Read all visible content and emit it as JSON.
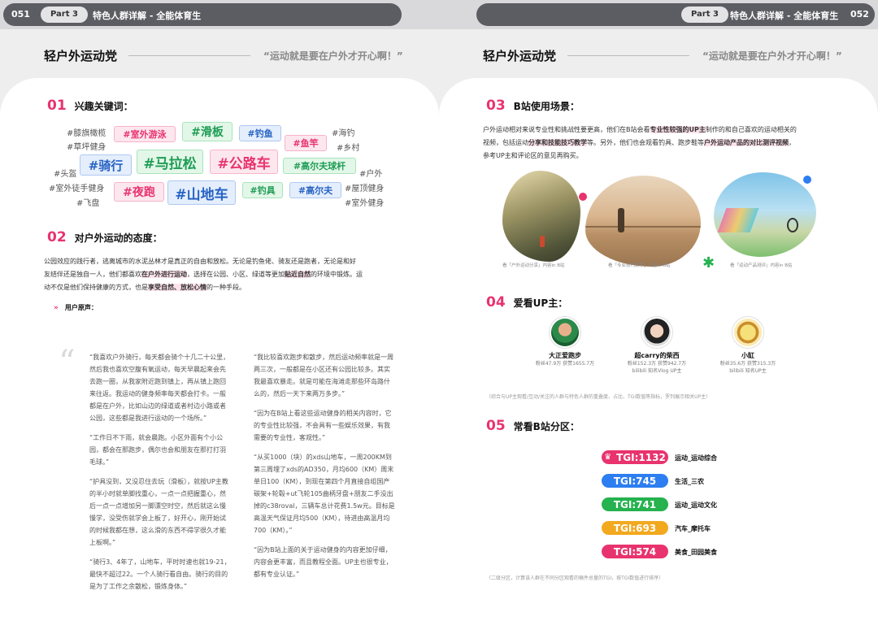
{
  "header": {
    "page_left": "051",
    "page_right": "052",
    "part_left": "Part 3",
    "part_right": "Part 3",
    "title_left": "特色人群详解 - 全能体育生",
    "title_right": "特色人群详解 - 全能体育生"
  },
  "left": {
    "heading": "轻户外运动党",
    "quote": "“运动就是要在户外才开心啊！”",
    "s1_num": "01",
    "s1_title": "兴趣关键词：",
    "keywords": [
      "#膝旗橄榄",
      "#草坪健身",
      "#头盔",
      "#室外徒手健身",
      "#飞盘",
      "#海钓",
      "#乡村",
      "#户外",
      "#屋顶健身",
      "#室外健身"
    ],
    "tags": [
      "#室外游泳",
      "#滑板",
      "#钓鱼",
      "#鱼竿",
      "#骑行",
      "#马拉松",
      "#公路车",
      "#高尔夫球杆",
      "#夜跑",
      "#山地车",
      "#钓具",
      "#高尔夫"
    ],
    "s2_num": "02",
    "s2_title": "对户外运动的态度：",
    "attitude": {
      "p1": "公园效应的践行者，逃离城市的水泥丛林才是真正的自由和放松。无论是钓鱼佬、骑友还是跑者，无论是和好",
      "p2a": "友结伴还是独自一人，他们都喜欢",
      "p2h": "在户外进行运动",
      "p2b": "，选择在公园、小区、绿道等更加",
      "p2h2": "贴近自然",
      "p2c": "的环境中锻炼。运",
      "p3a": "动不仅是他们保持健康的方式，也是",
      "p3h": "享受自然、放松心情",
      "p3b": "的一种手段。"
    },
    "voice_label": "用户原声：",
    "quotes_left": [
      "“我喜欢户外骑行，每天都会骑个十几二十公里，然后我也喜欢空腹有氧运动，每天早晨起来会先去跑一圈，从我家附近跑到镇上，再从镇上跑回来往返。我运动的健身频率每天都会打卡。一般都是在户外，比如山边的绿道或者村边小路或者公园，这些都是我进行运动的一个场所。”",
      "“工作日不下雨，就会晨跑。小区外面有个小公园，都会在那跑步，偶尔也会和朋友在那打打羽毛球。”",
      "“护具没到，又没忍住去玩（滑板），就按UP主教的半小时就单脚找重心，一点一点把握重心，然后一点一点增加另一脚漂空时空，然后就这么慢慢学，没受伤就学会上板了，好开心，刚开始试的时候我都在想，这么滑的东西不得学很久才能上板啊。”",
      "“骑行3、4年了，山地车，平时时速也就19-21，最快不超过22。一个人骑行看自由。骑行的目的是为了工作之余散松，锻炼身体。”"
    ],
    "quotes_right": [
      "“我比较喜欢跑步和散步，然后运动频率就是一周两三次，一般都是在小区还有公园比较多。其实我最喜欢暴走。就是可能在海滩走那些环岛路什么的，然后一天下来两万多步。”",
      "“因为在B站上看这些运动健身的相关内容时，它的专业性比较强，不会具有一些娱乐效果，有我需要的专业性，客观性。”",
      "“从买1000（块）的xds山地车，一周200KM到第三周埋了xds的AD350，月均600（KM）周末单日100（KM），到现在第四个月直接自组国产碳架+轮毂+ut飞轮105曲柄牙盘+朋友二手没出掉的c38roval，三辆车总计花费1.5w元。目标是高温天气保证月均500（KM），待进由高温月均700（KM）。”",
      "“因为B站上面的关于运动健身的内容更加仔细，内容会更丰富，而且教程全面。UP主也很专业，都有专业认证。”"
    ]
  },
  "right": {
    "heading": "轻户外运动党",
    "quote": "“运动就是要在户外才开心啊！”",
    "s3_num": "03",
    "s3_title": "B站使用场景：",
    "scene": {
      "l1a": "户外运动相对来说专业性和挑战性要更高，他们在B站会看",
      "l1h": "专业性较强的UP主",
      "l1b": "制作的和自己喜欢的运动相关的",
      "l2a": "视频，包括运动",
      "l2h": "分享和技能技巧教学",
      "l2b": "等。另外，他们也会观看钓具、跑步鞋等",
      "l2h2": "户外运动产品的对比测评视频",
      "l2c": "，",
      "l3": "参考UP主和评论区的意见再购买。"
    },
    "captions": [
      "看「户外运动分享」内容in B站",
      "看「专业技巧教学」内容in B站",
      "看「运动产品测评」内容in B站"
    ],
    "s4_num": "04",
    "s4_title": "爱看UP主：",
    "ups": [
      {
        "name": "大正爱跑步",
        "stats": "粉丝47.9万 获赞1655.7万",
        "extra": ""
      },
      {
        "name": "超carry的柴西",
        "stats": "粉丝152.3万 获赞942.7万",
        "extra": "bilibili 知名Vlog UP主"
      },
      {
        "name": "小缸",
        "stats": "粉丝35.6万 获赞315.3万",
        "extra": "bilibili 知名UP主"
      }
    ],
    "up_note": "（综合与UP主观看/互动/关注的人群与特色人群的重叠度、占比、TGI数值等指标，罗列展示相关UP主）",
    "s5_num": "05",
    "s5_title": "常看B站分区：",
    "zones": [
      {
        "tgi": "TGI:1132",
        "label": "运动_运动综合",
        "color": "#e8336f"
      },
      {
        "tgi": "TGI:745",
        "label": "生活_三农",
        "color": "#2d7ef0"
      },
      {
        "tgi": "TGI:741",
        "label": "运动_运动文化",
        "color": "#25b24f"
      },
      {
        "tgi": "TGI:693",
        "label": "汽车_摩托车",
        "color": "#f2a91f"
      },
      {
        "tgi": "TGI:574",
        "label": "美食_田园美食",
        "color": "#e8336f"
      }
    ],
    "zone_note": "（二级分区，计算该人群在不同分区观看的稿件总量的TGI，按TGI数值进行排序）"
  }
}
